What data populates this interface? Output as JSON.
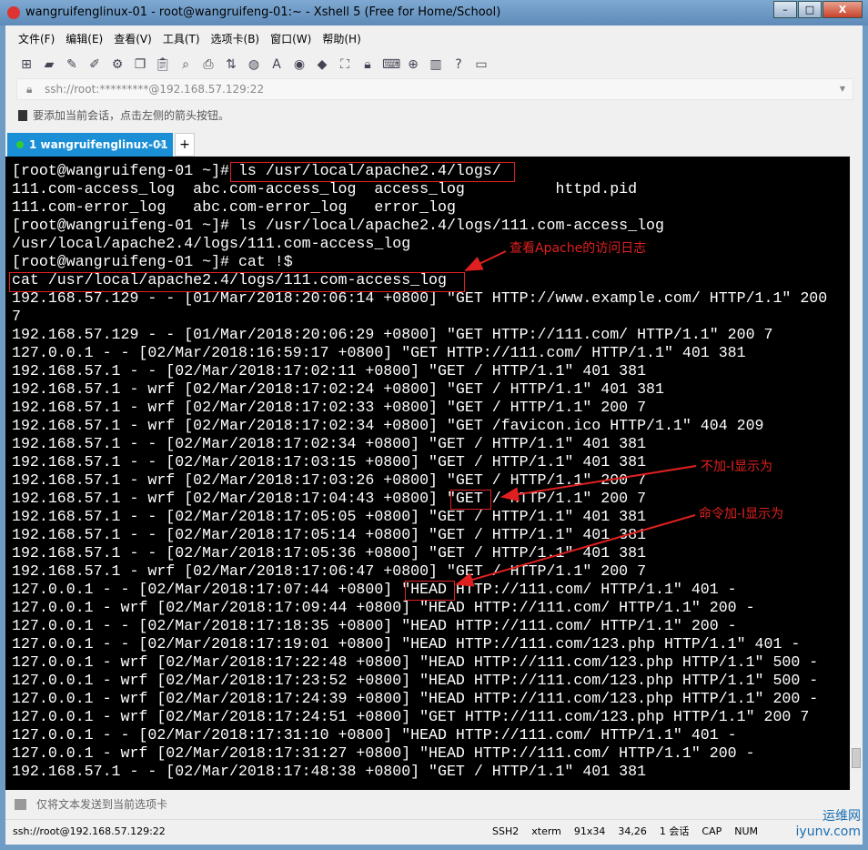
{
  "window": {
    "title": "wangruifenglinux-01 - root@wangruifeng-01:~ - Xshell 5 (Free for Home/School)",
    "minimize": "–",
    "maximize": "□",
    "close": "X"
  },
  "menu": [
    "文件(F)",
    "编辑(E)",
    "查看(V)",
    "工具(T)",
    "选项卡(B)",
    "窗口(W)",
    "帮助(H)"
  ],
  "toolbar_icons": [
    "new-session-icon",
    "open-icon",
    "connect-icon",
    "disconnect-icon",
    "properties-icon",
    "copy-icon",
    "paste-icon",
    "find-icon",
    "print-icon",
    "transfer-icon",
    "globe-icon",
    "font-icon",
    "xftp-icon",
    "xmanager-icon",
    "fullscreen-icon",
    "lock-icon",
    "keyboard-icon",
    "new-tab-icon",
    "layout-icon",
    "help-icon",
    "chat-icon"
  ],
  "address": "ssh://root:*********@192.168.57.129:22",
  "hint": "要添加当前会话，点击左侧的箭头按钮。",
  "tab": {
    "label": "1 wangruifenglinux-01",
    "close": "×",
    "add": "+"
  },
  "terminal": {
    "lines": [
      "[root@wangruifeng-01 ~]# ls /usr/local/apache2.4/logs/",
      "111.com-access_log  abc.com-access_log  access_log          httpd.pid",
      "111.com-error_log   abc.com-error_log   error_log",
      "[root@wangruifeng-01 ~]# ls /usr/local/apache2.4/logs/111.com-access_log",
      "/usr/local/apache2.4/logs/111.com-access_log",
      "[root@wangruifeng-01 ~]# cat !$",
      "cat /usr/local/apache2.4/logs/111.com-access_log",
      "192.168.57.129 - - [01/Mar/2018:20:06:14 +0800] \"GET HTTP://www.example.com/ HTTP/1.1\" 200",
      "7",
      "192.168.57.129 - - [01/Mar/2018:20:06:29 +0800] \"GET HTTP://111.com/ HTTP/1.1\" 200 7",
      "127.0.0.1 - - [02/Mar/2018:16:59:17 +0800] \"GET HTTP://111.com/ HTTP/1.1\" 401 381",
      "192.168.57.1 - - [02/Mar/2018:17:02:11 +0800] \"GET / HTTP/1.1\" 401 381",
      "192.168.57.1 - wrf [02/Mar/2018:17:02:24 +0800] \"GET / HTTP/1.1\" 401 381",
      "192.168.57.1 - wrf [02/Mar/2018:17:02:33 +0800] \"GET / HTTP/1.1\" 200 7",
      "192.168.57.1 - wrf [02/Mar/2018:17:02:34 +0800] \"GET /favicon.ico HTTP/1.1\" 404 209",
      "192.168.57.1 - - [02/Mar/2018:17:02:34 +0800] \"GET / HTTP/1.1\" 401 381",
      "192.168.57.1 - - [02/Mar/2018:17:03:15 +0800] \"GET / HTTP/1.1\" 401 381",
      "192.168.57.1 - wrf [02/Mar/2018:17:03:26 +0800] \"GET / HTTP/1.1\" 200 7",
      "192.168.57.1 - wrf [02/Mar/2018:17:04:43 +0800] \"GET / HTTP/1.1\" 200 7",
      "192.168.57.1 - - [02/Mar/2018:17:05:05 +0800] \"GET / HTTP/1.1\" 401 381",
      "192.168.57.1 - - [02/Mar/2018:17:05:14 +0800] \"GET / HTTP/1.1\" 401 381",
      "192.168.57.1 - - [02/Mar/2018:17:05:36 +0800] \"GET / HTTP/1.1\" 401 381",
      "192.168.57.1 - wrf [02/Mar/2018:17:06:47 +0800] \"GET / HTTP/1.1\" 200 7",
      "127.0.0.1 - - [02/Mar/2018:17:07:44 +0800] \"HEAD HTTP://111.com/ HTTP/1.1\" 401 -",
      "127.0.0.1 - wrf [02/Mar/2018:17:09:44 +0800] \"HEAD HTTP://111.com/ HTTP/1.1\" 200 -",
      "127.0.0.1 - - [02/Mar/2018:17:18:35 +0800] \"HEAD HTTP://111.com/ HTTP/1.1\" 200 -",
      "127.0.0.1 - - [02/Mar/2018:17:19:01 +0800] \"HEAD HTTP://111.com/123.php HTTP/1.1\" 401 -",
      "127.0.0.1 - wrf [02/Mar/2018:17:22:48 +0800] \"HEAD HTTP://111.com/123.php HTTP/1.1\" 500 -",
      "127.0.0.1 - wrf [02/Mar/2018:17:23:52 +0800] \"HEAD HTTP://111.com/123.php HTTP/1.1\" 500 -",
      "127.0.0.1 - wrf [02/Mar/2018:17:24:39 +0800] \"HEAD HTTP://111.com/123.php HTTP/1.1\" 200 -",
      "127.0.0.1 - wrf [02/Mar/2018:17:24:51 +0800] \"GET HTTP://111.com/123.php HTTP/1.1\" 200 7",
      "127.0.0.1 - - [02/Mar/2018:17:31:10 +0800] \"HEAD HTTP://111.com/ HTTP/1.1\" 401 -",
      "127.0.0.1 - wrf [02/Mar/2018:17:31:27 +0800] \"HEAD HTTP://111.com/ HTTP/1.1\" 200 -",
      "192.168.57.1 - - [02/Mar/2018:17:48:38 +0800] \"GET / HTTP/1.1\" 401 381"
    ]
  },
  "annotations": {
    "view_log": "查看Apache的访问日志",
    "without_i": "不加-I显示为",
    "with_i": "命令加-I显示为",
    "color": "#e02020"
  },
  "sendbar": "仅将文本发送到当前选项卡",
  "status": {
    "conn": "ssh://root@192.168.57.129:22",
    "proto": "SSH2",
    "term": "xterm",
    "size": "91x34",
    "pos": "34,26",
    "sessions": "1 会话",
    "caps": "CAP",
    "num": "NUM"
  },
  "watermark": {
    "cn": "运维网",
    "en": "iyunv.com"
  }
}
